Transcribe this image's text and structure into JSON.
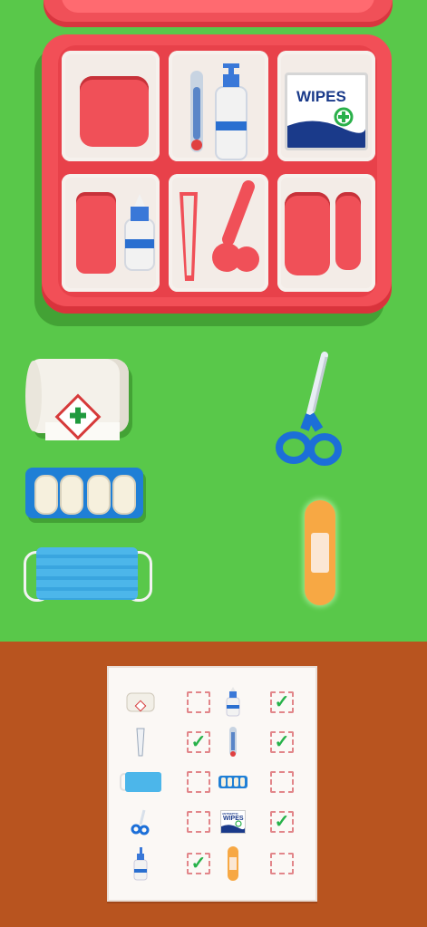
{
  "game": {
    "scene": "first-aid kit sorting",
    "colors": {
      "grass": "#59c84a",
      "floor": "#b8541f",
      "kit": "#f24f57",
      "accent_check": "#27b24a"
    }
  },
  "kit": {
    "wipes_label": "WIPES"
  },
  "floor_items": [
    {
      "name": "bandage-roll"
    },
    {
      "name": "pill-blister"
    },
    {
      "name": "face-mask"
    },
    {
      "name": "scissors"
    },
    {
      "name": "adhesive-plaster"
    }
  ],
  "checklist": {
    "rows": [
      {
        "left_item": "bandage-roll",
        "left_checked": false,
        "right_item": "dropper-bottle",
        "right_checked": true
      },
      {
        "left_item": "tweezers",
        "left_checked": true,
        "right_item": "thermometer",
        "right_checked": true
      },
      {
        "left_item": "face-mask",
        "left_checked": false,
        "right_item": "pill-blister",
        "right_checked": false
      },
      {
        "left_item": "scissors",
        "left_checked": false,
        "right_item": "wipes",
        "right_checked": true
      },
      {
        "left_item": "pump-bottle",
        "left_checked": true,
        "right_item": "adhesive-plaster",
        "right_checked": false
      }
    ],
    "check_glyph": "✓",
    "mini_wipes_small": "ANTISEPTIC",
    "mini_wipes_label": "WIPES"
  }
}
